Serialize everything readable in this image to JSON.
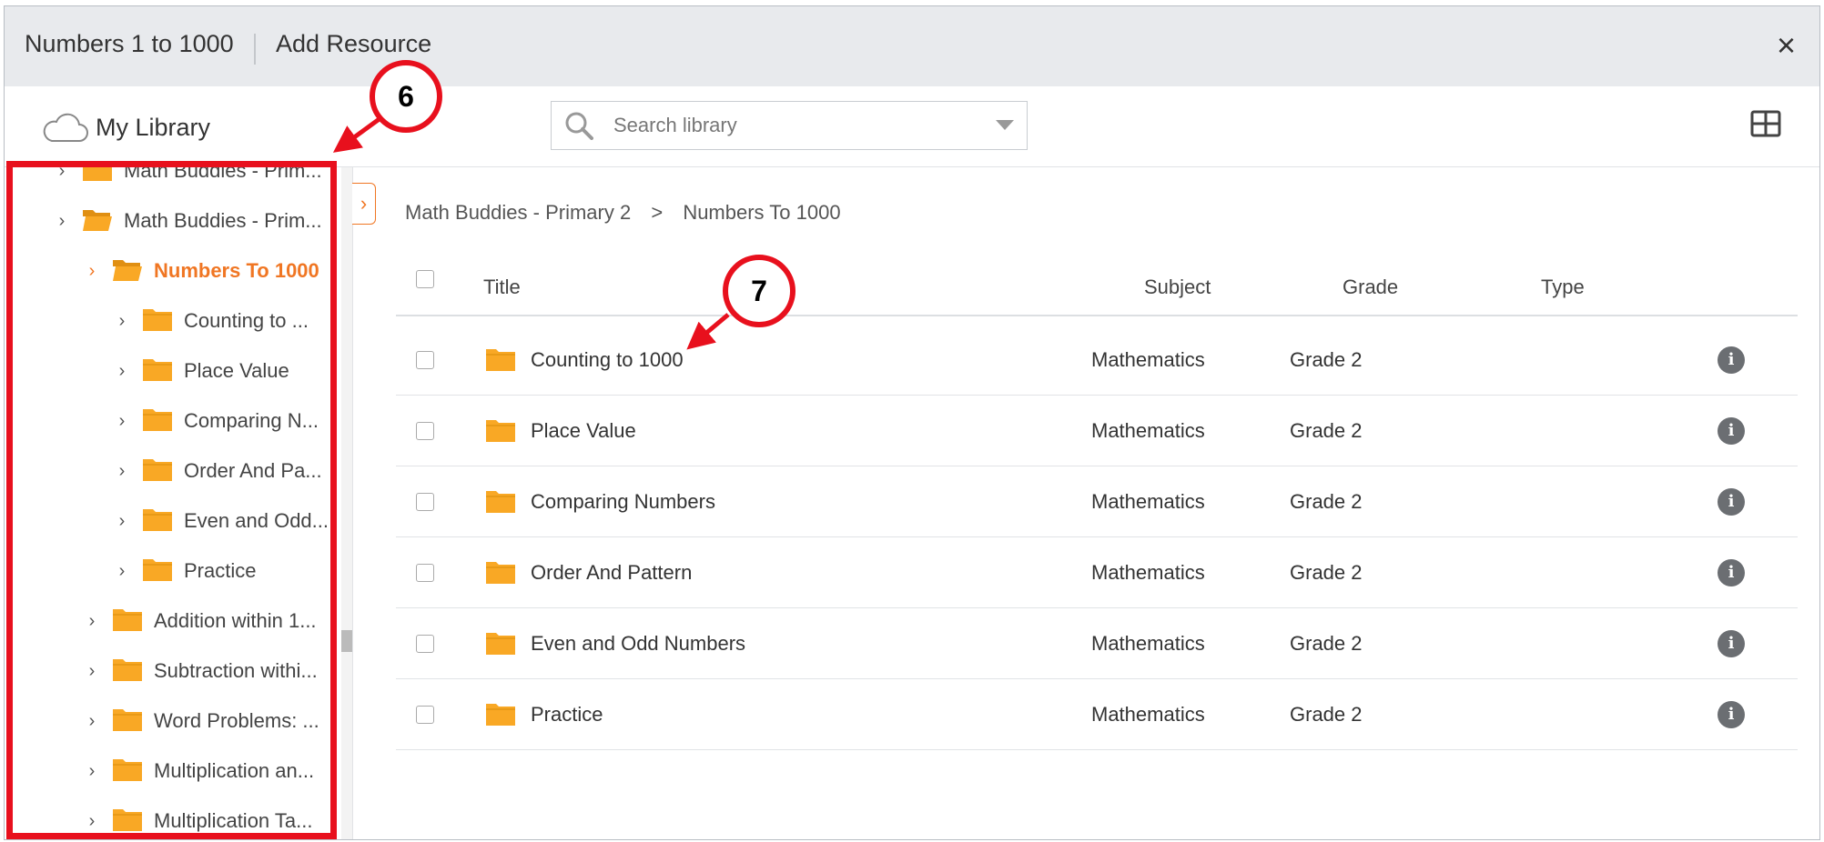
{
  "header": {
    "title": "Numbers 1 to 1000",
    "subtitle": "Add Resource",
    "close_label": "×"
  },
  "toolbar": {
    "library_label": "My Library",
    "search_placeholder": "Search library"
  },
  "sidebar": {
    "items": [
      {
        "label": "Math Buddies - Prim...",
        "level": 0,
        "open": false,
        "active": false
      },
      {
        "label": "Math Buddies - Prim...",
        "level": 0,
        "open": true,
        "active": false
      },
      {
        "label": "Numbers To 1000",
        "level": 1,
        "open": true,
        "active": true
      },
      {
        "label": "Counting to ...",
        "level": 2,
        "open": false,
        "active": false
      },
      {
        "label": "Place Value",
        "level": 2,
        "open": false,
        "active": false
      },
      {
        "label": "Comparing N...",
        "level": 2,
        "open": false,
        "active": false
      },
      {
        "label": "Order And Pa...",
        "level": 2,
        "open": false,
        "active": false
      },
      {
        "label": "Even and Odd...",
        "level": 2,
        "open": false,
        "active": false
      },
      {
        "label": "Practice",
        "level": 2,
        "open": false,
        "active": false
      },
      {
        "label": "Addition within 1...",
        "level": 1,
        "open": false,
        "active": false
      },
      {
        "label": "Subtraction withi...",
        "level": 1,
        "open": false,
        "active": false
      },
      {
        "label": "Word Problems: ...",
        "level": 1,
        "open": false,
        "active": false
      },
      {
        "label": "Multiplication an...",
        "level": 1,
        "open": false,
        "active": false
      },
      {
        "label": "Multiplication Ta...",
        "level": 1,
        "open": false,
        "active": false
      }
    ]
  },
  "breadcrumb": {
    "items": [
      "Math Buddies - Primary 2",
      "Numbers To 1000"
    ],
    "separator": ">"
  },
  "table": {
    "columns": {
      "title": "Title",
      "subject": "Subject",
      "grade": "Grade",
      "type": "Type"
    },
    "rows": [
      {
        "title": "Counting to 1000",
        "subject": "Mathematics",
        "grade": "Grade 2",
        "type": ""
      },
      {
        "title": "Place Value",
        "subject": "Mathematics",
        "grade": "Grade 2",
        "type": ""
      },
      {
        "title": "Comparing Numbers",
        "subject": "Mathematics",
        "grade": "Grade 2",
        "type": ""
      },
      {
        "title": "Order And Pattern",
        "subject": "Mathematics",
        "grade": "Grade 2",
        "type": ""
      },
      {
        "title": "Even and Odd Numbers",
        "subject": "Mathematics",
        "grade": "Grade 2",
        "type": ""
      },
      {
        "title": "Practice",
        "subject": "Mathematics",
        "grade": "Grade 2",
        "type": ""
      }
    ]
  },
  "annotations": {
    "step_a": "6",
    "step_b": "7"
  },
  "colors": {
    "accent": "#f07623",
    "folder": "#f9a825",
    "annotation": "#e8101d"
  }
}
